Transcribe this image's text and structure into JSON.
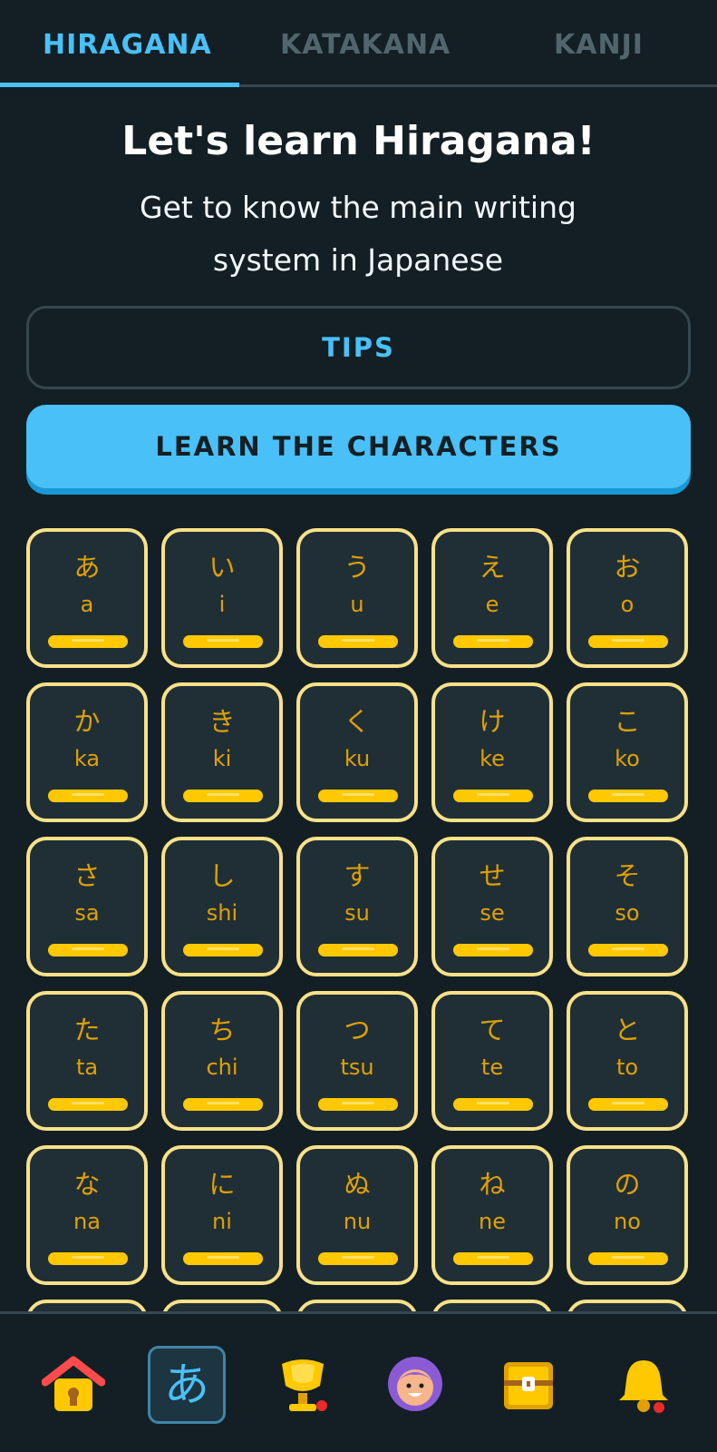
{
  "tabs": [
    {
      "label": "HIRAGANA",
      "active": true
    },
    {
      "label": "KATAKANA",
      "active": false
    },
    {
      "label": "KANJI",
      "active": false
    }
  ],
  "header": {
    "title": "Let's learn Hiragana!",
    "subtitle_line1": "Get to know the main writing",
    "subtitle_line2": "system in Japanese"
  },
  "buttons": {
    "tips": "TIPS",
    "learn": "LEARN THE CHARACTERS"
  },
  "characters": [
    {
      "kana": "あ",
      "romaji": "a"
    },
    {
      "kana": "い",
      "romaji": "i"
    },
    {
      "kana": "う",
      "romaji": "u"
    },
    {
      "kana": "え",
      "romaji": "e"
    },
    {
      "kana": "お",
      "romaji": "o"
    },
    {
      "kana": "か",
      "romaji": "ka"
    },
    {
      "kana": "き",
      "romaji": "ki"
    },
    {
      "kana": "く",
      "romaji": "ku"
    },
    {
      "kana": "け",
      "romaji": "ke"
    },
    {
      "kana": "こ",
      "romaji": "ko"
    },
    {
      "kana": "さ",
      "romaji": "sa"
    },
    {
      "kana": "し",
      "romaji": "shi"
    },
    {
      "kana": "す",
      "romaji": "su"
    },
    {
      "kana": "せ",
      "romaji": "se"
    },
    {
      "kana": "そ",
      "romaji": "so"
    },
    {
      "kana": "た",
      "romaji": "ta"
    },
    {
      "kana": "ち",
      "romaji": "chi"
    },
    {
      "kana": "つ",
      "romaji": "tsu"
    },
    {
      "kana": "て",
      "romaji": "te"
    },
    {
      "kana": "と",
      "romaji": "to"
    },
    {
      "kana": "な",
      "romaji": "na"
    },
    {
      "kana": "に",
      "romaji": "ni"
    },
    {
      "kana": "ぬ",
      "romaji": "nu"
    },
    {
      "kana": "ね",
      "romaji": "ne"
    },
    {
      "kana": "の",
      "romaji": "no"
    }
  ],
  "bottom_nav": {
    "items": [
      {
        "icon": "home-icon",
        "active": false
      },
      {
        "icon": "characters-icon",
        "glyph": "あ",
        "active": true
      },
      {
        "icon": "leaderboard-trophy-icon",
        "active": false
      },
      {
        "icon": "profile-avatar-icon",
        "active": false
      },
      {
        "icon": "treasure-chest-icon",
        "active": false
      },
      {
        "icon": "notifications-bell-icon",
        "active": false
      }
    ]
  },
  "colors": {
    "background": "#131f24",
    "accent_blue": "#49c0f8",
    "cell_border": "#f8e188",
    "cell_text": "#e0a100",
    "progress_bar": "#ffc800",
    "notification_dot": "#ea2b2b"
  }
}
